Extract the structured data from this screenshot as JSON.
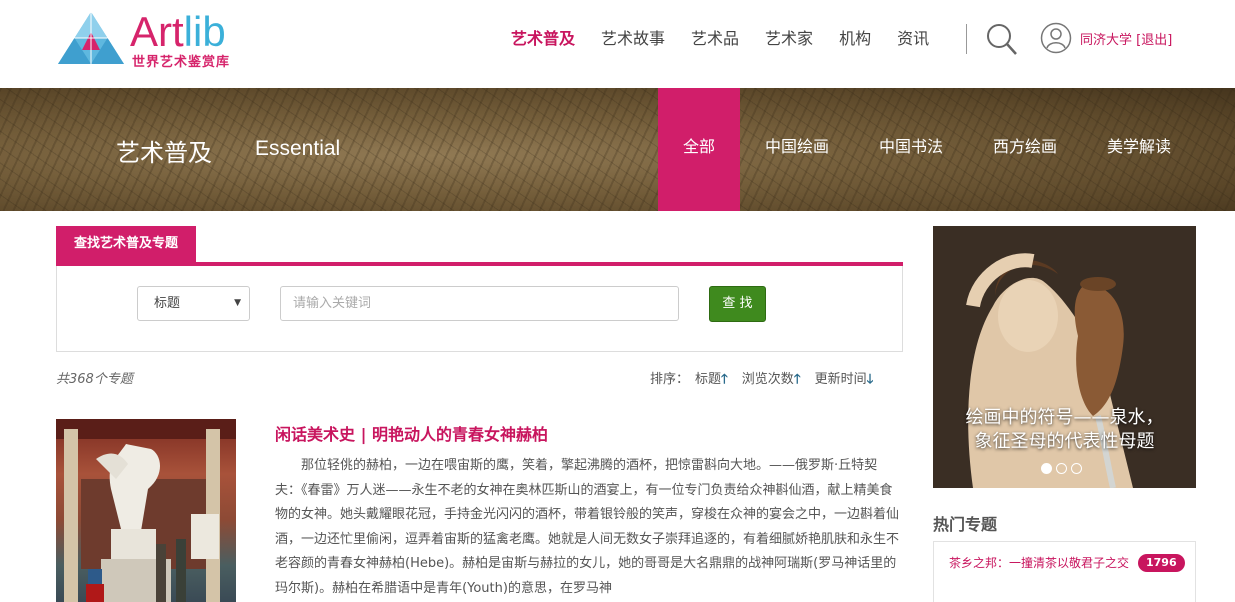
{
  "brand": {
    "name_art": "Art",
    "name_lib": "lib",
    "tagline": "世界艺术鉴赏库",
    "accent": "#d11e6a",
    "secondary": "#3bb0d9"
  },
  "nav": {
    "items": [
      {
        "label": "艺术普及",
        "active": true
      },
      {
        "label": "艺术故事"
      },
      {
        "label": "艺术品"
      },
      {
        "label": "艺术家"
      },
      {
        "label": "机构"
      },
      {
        "label": "资讯"
      }
    ],
    "user_label": "同济大学 [退出]"
  },
  "banner": {
    "title": "艺术普及",
    "title_en": "Essential",
    "tabs": [
      {
        "label": "全部",
        "active": true
      },
      {
        "label": "中国绘画"
      },
      {
        "label": "中国书法"
      },
      {
        "label": "西方绘画"
      },
      {
        "label": "美学解读"
      }
    ]
  },
  "search": {
    "tab_label": "查找艺术普及专题",
    "select_value": "标题",
    "input_placeholder": "请输入关键词",
    "button_label": "查 找"
  },
  "results": {
    "count_text": "共368个专题",
    "sort_label": "排序：",
    "sort_options": [
      {
        "label": "标题",
        "arrow": "🡑"
      },
      {
        "label": "浏览次数",
        "arrow": "🡑"
      },
      {
        "label": "更新时间",
        "arrow": "🡓"
      }
    ]
  },
  "article": {
    "title": "闲话美术史 | 明艳动人的青春女神赫柏",
    "excerpt": "那位轻佻的赫柏，一边在喂宙斯的鹰，笑着，擎起沸腾的酒杯，把惊雷斟向大地。——俄罗斯·丘特契夫：《春雷》万人迷——永生不老的女神在奥林匹斯山的酒宴上，有一位专门负责给众神斟仙酒，献上精美食物的女神。她头戴耀眼花冠，手持金光闪闪的酒杯，带着银铃般的笑声，穿梭在众神的宴会之中，一边斟着仙酒，一边还忙里偷闲，逗弄着宙斯的猛禽老鹰。她就是人间无数女子崇拜追逐的，有着细腻娇艳肌肤和永生不老容颜的青春女神赫柏(Hebe)。赫柏是宙斯与赫拉的女儿，她的哥哥是大名鼎鼎的战神阿瑞斯(罗马神话里的玛尔斯)。赫柏在希腊语中是青年(Youth)的意思，在罗马神"
  },
  "sidebar": {
    "feature_caption_1": "绘画中的符号——泉水，",
    "feature_caption_2": "象征圣母的代表性母题",
    "hot_title": "热门专题",
    "hot_items": [
      {
        "text": "茶乡之邦：一撞清茶以敬君子之交",
        "count": "1796"
      }
    ]
  }
}
